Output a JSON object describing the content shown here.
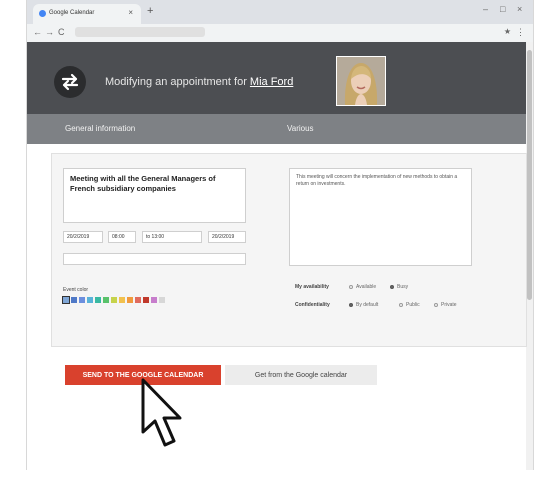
{
  "browser": {
    "tab_title": "Google Calendar",
    "tab_close": "×",
    "new_tab": "+",
    "window_min": "–",
    "window_max": "□",
    "window_close": "×",
    "nav_back": "←",
    "nav_forward": "→",
    "reload": "C",
    "menu": "⋮",
    "extension": "★"
  },
  "header": {
    "title_prefix": "Modifying an appointment for ",
    "user_name": "Mia Ford"
  },
  "sections": {
    "general": "General information",
    "various": "Various"
  },
  "form": {
    "title": "Meeting with all the General Managers of French subsidiary companies",
    "description": "This meeting will concern the implementation of new methods to obtain a return on investments.",
    "start_date": "20/2/2019",
    "start_time": "08:00",
    "end_time": "to 13:00",
    "end_date": "20/2/2019",
    "location": "",
    "event_color_label": "Event color",
    "event_colors": [
      "#7fa6d6",
      "#4f79c7",
      "#6c8fde",
      "#59b3d8",
      "#39b9a2",
      "#59c26b",
      "#c6d34b",
      "#f2c14e",
      "#f09a3e",
      "#e06b5d",
      "#c0392b",
      "#c77dcc",
      "#d7d7d7"
    ],
    "availability_label": "My availability",
    "availability_options": [
      "Available",
      "Busy"
    ],
    "availability_selected": "Busy",
    "confidentiality_label": "Confidentiality",
    "confidentiality_options": [
      "By default",
      "Public",
      "Private"
    ],
    "confidentiality_selected": "By default"
  },
  "actions": {
    "send": "SEND TO THE GOOGLE CALENDAR",
    "get": "Get from the Google calendar"
  }
}
